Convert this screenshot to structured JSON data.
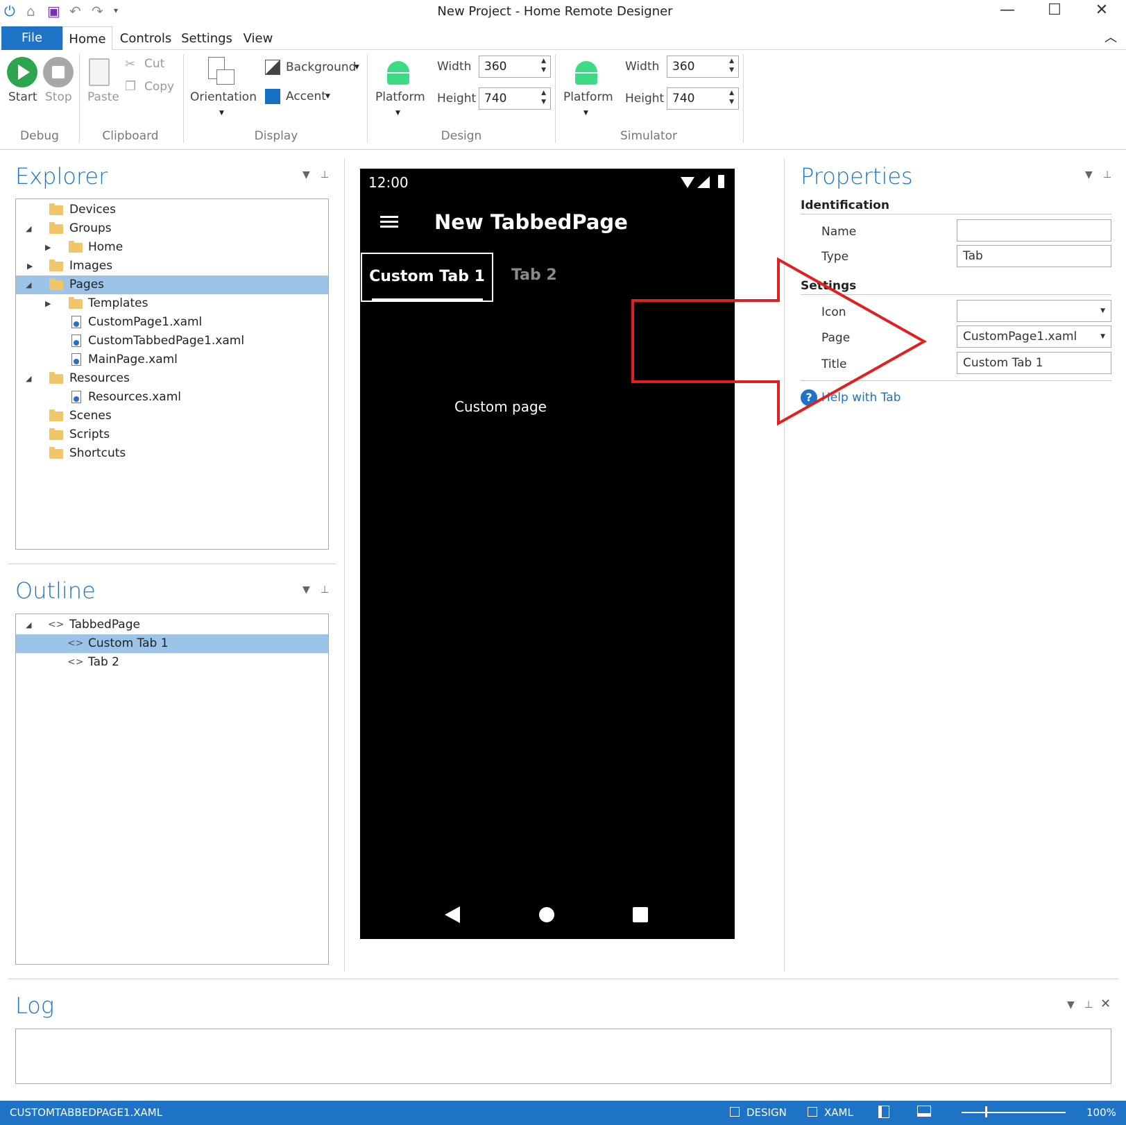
{
  "window": {
    "title": "New Project - Home Remote Designer",
    "controls": {
      "minimize": "—",
      "maximize": "☐",
      "close": "✕"
    }
  },
  "menu": {
    "file": "File",
    "tabs": [
      "Home",
      "Controls",
      "Settings",
      "View"
    ]
  },
  "ribbon": {
    "debug": {
      "start": "Start",
      "stop": "Stop",
      "group": "Debug"
    },
    "clipboard": {
      "paste": "Paste",
      "cut": "Cut",
      "copy": "Copy",
      "group": "Clipboard"
    },
    "display": {
      "orientation": "Orientation",
      "background": "Background",
      "accent": "Accent",
      "group": "Display",
      "accent_color": "#1570c4"
    },
    "design": {
      "platform": "Platform",
      "width_label": "Width",
      "width": "360",
      "height_label": "Height",
      "height": "740",
      "group": "Design"
    },
    "simulator": {
      "platform": "Platform",
      "width_label": "Width",
      "width": "360",
      "height_label": "Height",
      "height": "740",
      "group": "Simulator"
    }
  },
  "explorer": {
    "title": "Explorer",
    "items": [
      "Devices",
      "Groups",
      "Home",
      "Images",
      "Pages",
      "Templates",
      "CustomPage1.xaml",
      "CustomTabbedPage1.xaml",
      "MainPage.xaml",
      "Resources",
      "Resources.xaml",
      "Scenes",
      "Scripts",
      "Shortcuts"
    ]
  },
  "outline": {
    "title": "Outline",
    "items": [
      "TabbedPage",
      "Custom Tab 1",
      "Tab 2"
    ]
  },
  "phone": {
    "time": "12:00",
    "header": "New TabbedPage",
    "tab1": "Custom Tab 1",
    "tab2": "Tab 2",
    "content": "Custom page"
  },
  "properties": {
    "title": "Properties",
    "identification": "Identification",
    "name_label": "Name",
    "name_value": "",
    "type_label": "Type",
    "type_value": "Tab",
    "settings": "Settings",
    "icon_label": "Icon",
    "icon_value": "",
    "page_label": "Page",
    "page_value": "CustomPage1.xaml",
    "title_label": "Title",
    "title_value": "Custom Tab 1",
    "help": "Help with Tab"
  },
  "log": {
    "title": "Log"
  },
  "status": {
    "file": "CUSTOMTABBEDPAGE1.XAML",
    "design": "DESIGN",
    "xaml": "XAML",
    "zoom": "100%"
  },
  "colors": {
    "accent": "#1e73c6",
    "selection": "#9bc4e8",
    "arrow": "#e02020"
  }
}
